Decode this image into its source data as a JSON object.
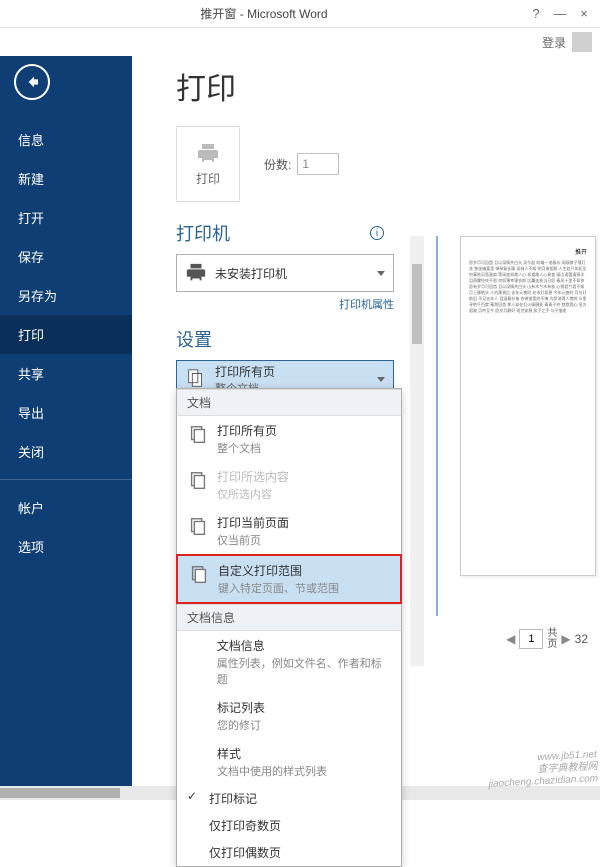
{
  "window": {
    "title": "推开窗 - Microsoft Word",
    "help": "?",
    "minimize": "—",
    "close": "×",
    "login": "登录"
  },
  "sidebar": {
    "items": [
      "信息",
      "新建",
      "打开",
      "保存",
      "另存为",
      "打印",
      "共享",
      "导出",
      "关闭"
    ],
    "footer": [
      "帐户",
      "选项"
    ],
    "active": 5
  },
  "print": {
    "title": "打印",
    "btn_label": "打印",
    "copies_label": "份数:",
    "copies_value": "1"
  },
  "printer": {
    "section": "打印机",
    "name": "未安装打印机",
    "props": "打印机属性"
  },
  "settings": {
    "section": "设置",
    "selected": {
      "title": "打印所有页",
      "sub": "整个文档"
    }
  },
  "dropdown": {
    "groups": [
      {
        "header": "文档",
        "items": [
          {
            "title": "打印所有页",
            "sub": "整个文档",
            "icon": "pages"
          },
          {
            "title": "打印所选内容",
            "sub": "仅所选内容",
            "icon": "page-plus",
            "disabled": true
          },
          {
            "title": "打印当前页面",
            "sub": "仅当前页",
            "icon": "page"
          },
          {
            "title": "自定义打印范围",
            "sub": "键入特定页面、节或范围",
            "icon": "pages-arrow",
            "highlight": true
          }
        ]
      },
      {
        "header": "文档信息",
        "simple": [
          {
            "title": "文档信息",
            "sub": "属性列表，例如文件名、作者和标题"
          },
          {
            "title": "标记列表",
            "sub": "您的修订"
          },
          {
            "title": "样式",
            "sub": "文档中使用的样式列表"
          }
        ]
      }
    ],
    "extras": [
      {
        "label": "打印标记",
        "checked": true
      },
      {
        "label": "仅打印奇数页",
        "checked": false
      },
      {
        "label": "仅打印偶数页",
        "checked": false
      }
    ]
  },
  "preview": {
    "heading": "推开",
    "current_page": "1",
    "total_label_1": "共",
    "total_label_2": "页",
    "total": "32"
  },
  "watermark": {
    "l1": "www.jb51.net",
    "l2": "查字典教程网",
    "l3": "jiaocheng.chazidian.com"
  }
}
